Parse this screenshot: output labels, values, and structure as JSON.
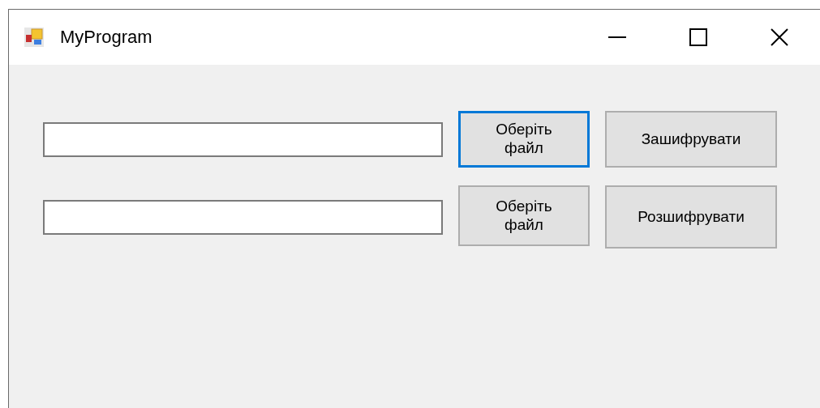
{
  "window": {
    "title": "MyProgram"
  },
  "rows": [
    {
      "browse_button": {
        "label": "Оберіть файл",
        "focused": true
      },
      "action_button": {
        "label": "Зашифрувати"
      }
    },
    {
      "browse_button": {
        "label": "Оберіть файл",
        "focused": false
      },
      "action_button": {
        "label": "Розшифрувати"
      }
    }
  ]
}
